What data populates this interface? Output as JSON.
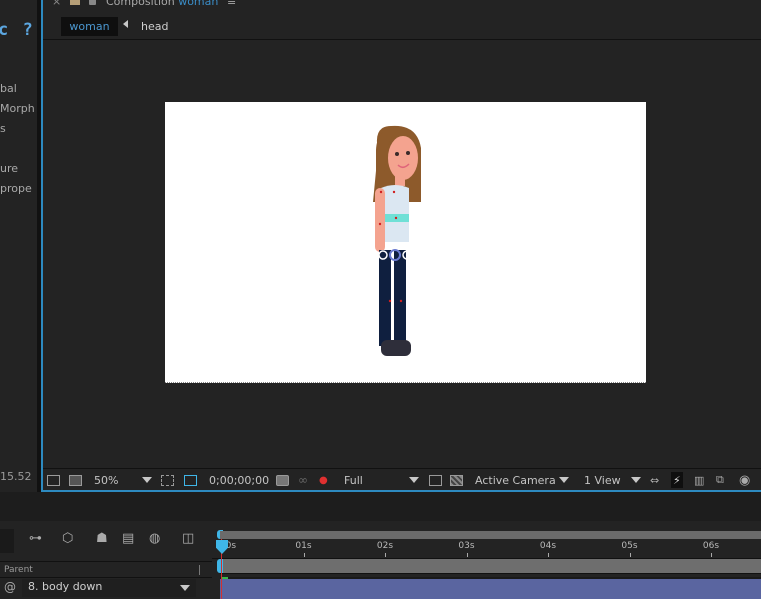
{
  "left_panel": {
    "help_glyphs": "c ?",
    "items": [
      "bal",
      "Morph",
      "s",
      "ure",
      "prope"
    ],
    "fps": "15.52"
  },
  "composition": {
    "tab_title_prefix": "Composition",
    "tab_title_name": "woman",
    "breadcrumbs": [
      "woman",
      "head"
    ],
    "canvas_background": "#ffffff"
  },
  "comp_toolbar": {
    "zoom": "50%",
    "timecode": "0;00;00;00",
    "resolution": "Full",
    "camera": "Active Camera",
    "views": "1 View"
  },
  "timeline": {
    "parent_header": "Parent",
    "layer_parent": "8. body down",
    "ruler_labels": [
      "00s",
      "01s",
      "02s",
      "03s",
      "04s",
      "05s",
      "06s"
    ],
    "current_time_seconds": 0,
    "colors": {
      "accent": "#3fb6e8",
      "playhead": "#d23030",
      "layer_bar": "#5a65a0"
    }
  },
  "colors": {
    "panel_border": "#2d8ac0",
    "accent_text": "#4b97cf"
  }
}
